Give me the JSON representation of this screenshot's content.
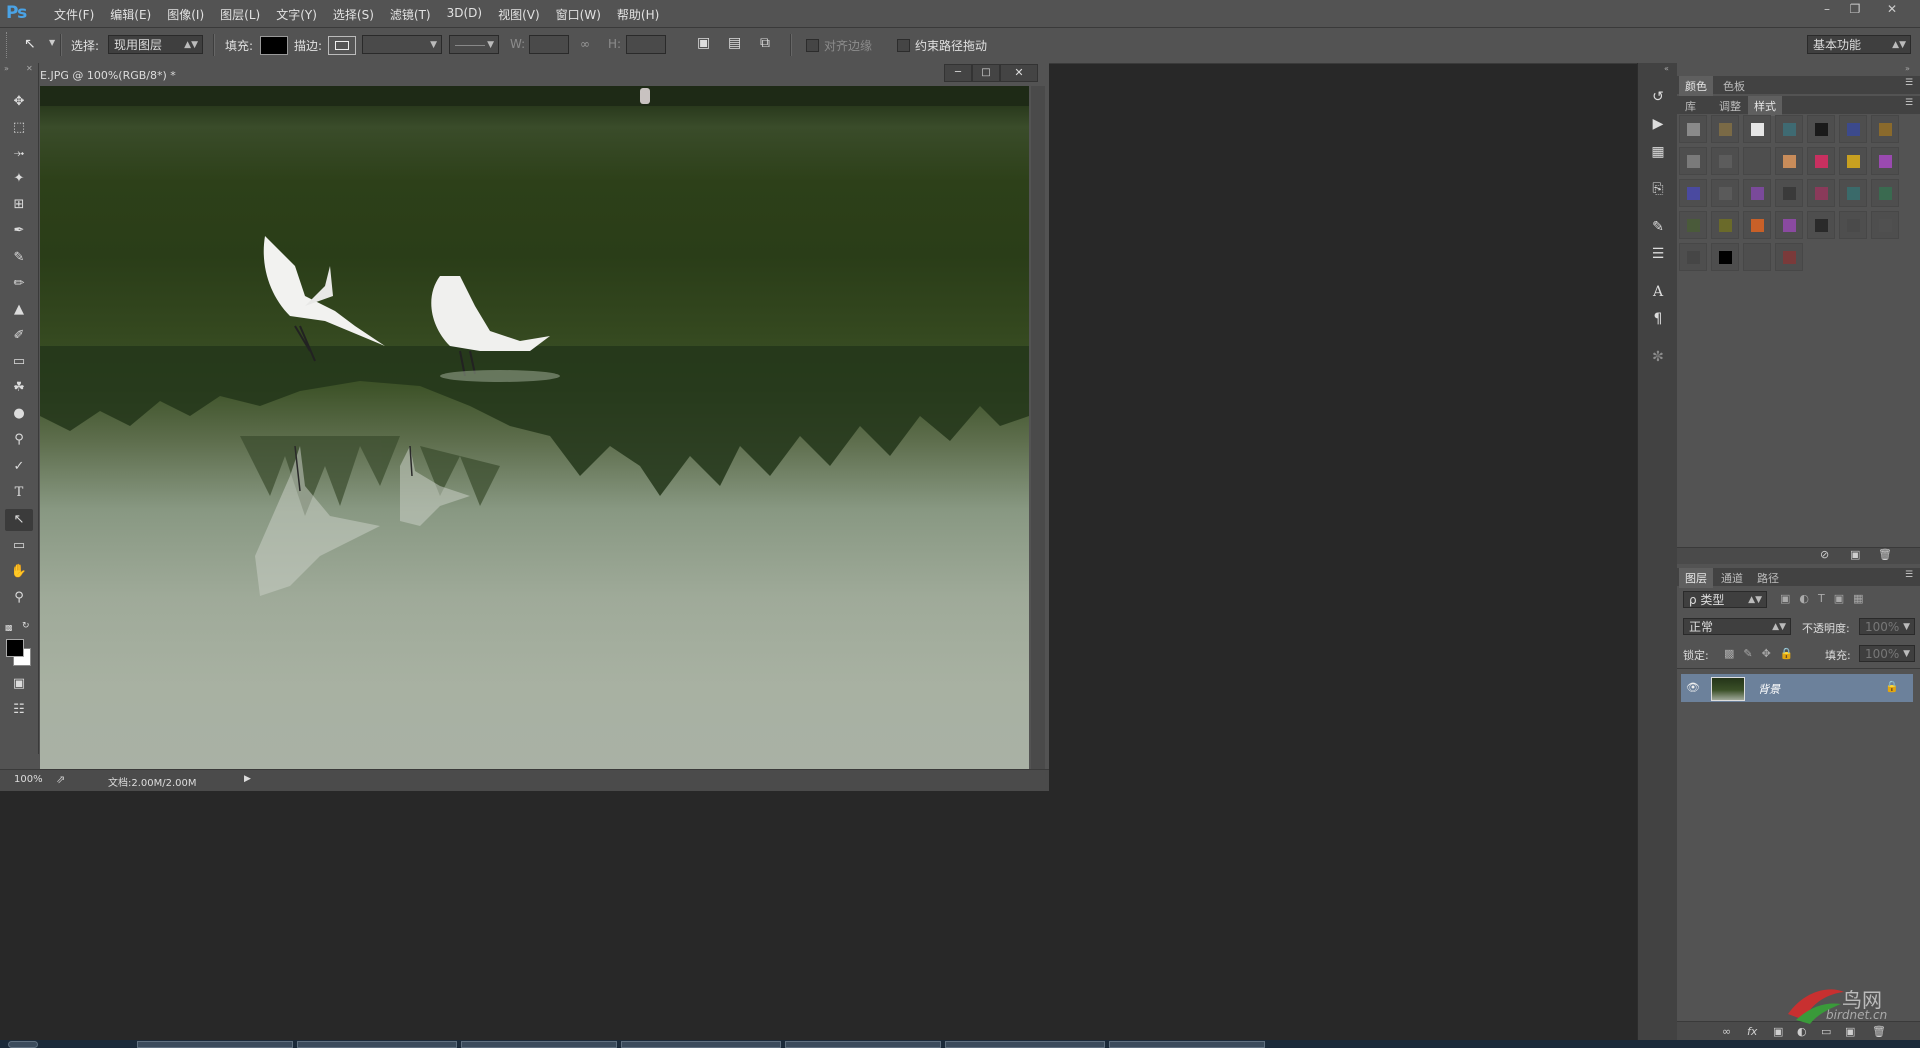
{
  "app": {
    "logo": "Ps"
  },
  "menu": [
    "文件(F)",
    "编辑(E)",
    "图像(I)",
    "图层(L)",
    "文字(Y)",
    "选择(S)",
    "滤镜(T)",
    "3D(D)",
    "视图(V)",
    "窗口(W)",
    "帮助(H)"
  ],
  "options": {
    "select_label": "选择:",
    "select_value": "现用图层",
    "fill_label": "填充:",
    "stroke_label": "描边:",
    "w_label": "W:",
    "h_label": "H:",
    "align_edges": "对齐边缘",
    "constrain_path": "约束路径拖动",
    "workspace": "基本功能"
  },
  "document": {
    "title": "E.JPG @ 100%(RGB/8*) *",
    "zoom": "100%",
    "doc_size": "文档:2.00M/2.00M"
  },
  "panels": {
    "color_tabs": [
      "颜色",
      "色板"
    ],
    "lib_tabs": [
      "库",
      "调整",
      "样式"
    ],
    "layer_tabs": [
      "图层",
      "通道",
      "路径"
    ],
    "kind_filter": "ρ 类型",
    "blend_mode": "正常",
    "opacity_label": "不透明度:",
    "opacity_value": "100%",
    "lock_label": "锁定:",
    "fill_label": "填充:",
    "fill_value": "100%",
    "layer_name": "背景"
  },
  "styles_colors": [
    "#8a8a8a",
    "#7a6a46",
    "#e6e6e6",
    "#3f6a72",
    "#1a1a1a",
    "#3c4a8c",
    "#8a6a2c",
    "#7a7a7a",
    "#5c5c5c",
    "#4e4e4e",
    "#c88c5a",
    "#c83060",
    "#c8a020",
    "#9a4ab0",
    "#4a4aa0",
    "#5a5a5a",
    "#7a4a9a",
    "#3a3a3a",
    "#8a3a5a",
    "#3a6a6a",
    "#3a6a50",
    "#4a5a3a",
    "#6a6a2a",
    "#c86028",
    "#8a4aa0",
    "#2a2a2a",
    "#4a4a4a",
    "#505050",
    "#464646",
    "#000000",
    "#4e4e4e",
    "#7a3a3a"
  ],
  "watermark": {
    "text": "鸟网",
    "url": "birdnet.cn"
  }
}
